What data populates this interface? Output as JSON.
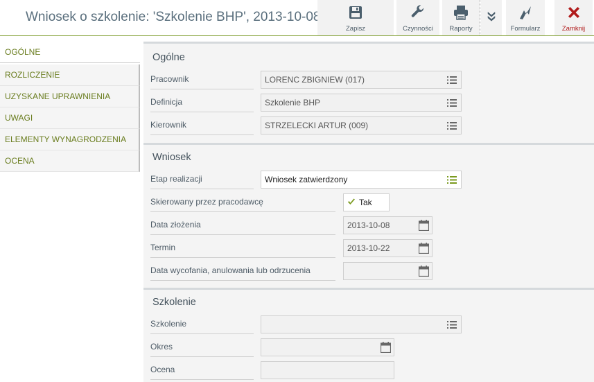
{
  "header": {
    "title": "Wniosek o szkolenie: 'Szkolenie BHP', 2013-10-08"
  },
  "toolbar": {
    "save": {
      "label": "Zapisz",
      "icon": "save-icon"
    },
    "actions": {
      "label": "Czynności",
      "icon": "wrench-icon"
    },
    "reports": {
      "label": "Raporty",
      "icon": "printer-icon"
    },
    "more": {
      "icon": "chevron-double-down-icon"
    },
    "form": {
      "label": "Formularz",
      "icon": "form-icon"
    },
    "close": {
      "label": "Zamknij",
      "icon": "close-icon"
    }
  },
  "sidebar": {
    "items": [
      {
        "label": "OGÓLNE",
        "active": true
      },
      {
        "label": "ROZLICZENIE",
        "active": false
      },
      {
        "label": "UZYSKANE UPRAWNIENIA",
        "active": false
      },
      {
        "label": "UWAGI",
        "active": false
      },
      {
        "label": "ELEMENTY WYNAGRODZENIA",
        "active": false
      },
      {
        "label": "OCENA",
        "active": false
      }
    ]
  },
  "sections": {
    "ogolne": {
      "title": "Ogólne",
      "fields": {
        "pracownik": {
          "label": "Pracownik",
          "value": "LORENC ZBIGNIEW (017)"
        },
        "definicja": {
          "label": "Definicja",
          "value": "Szkolenie BHP"
        },
        "kierownik": {
          "label": "Kierownik",
          "value": "STRZELECKI ARTUR (009)"
        }
      }
    },
    "wniosek": {
      "title": "Wniosek",
      "fields": {
        "etap": {
          "label": "Etap realizacji",
          "value": "Wniosek zatwierdzony"
        },
        "skierowany": {
          "label": "Skierowany przez pracodawcę",
          "value": "Tak",
          "checked": true
        },
        "data_zlozenia": {
          "label": "Data złożenia",
          "value": "2013-10-08"
        },
        "termin": {
          "label": "Termin",
          "value": "2013-10-22"
        },
        "data_wycofania": {
          "label": "Data wycofania, anulowania lub odrzucenia",
          "value": ""
        }
      }
    },
    "szkolenie": {
      "title": "Szkolenie",
      "fields": {
        "szkolenie": {
          "label": "Szkolenie",
          "value": ""
        },
        "okres": {
          "label": "Okres",
          "value": ""
        },
        "ocena": {
          "label": "Ocena",
          "value": ""
        }
      }
    }
  },
  "colors": {
    "accent_green": "#6a7d1f",
    "header_border": "#8faa4a",
    "close_red": "#b01a1a",
    "title_text": "#5a6f7d",
    "panel_bg": "#f4f4f4"
  }
}
